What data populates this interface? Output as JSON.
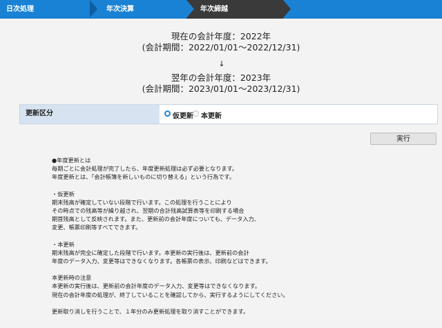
{
  "steps": [
    {
      "label": "日次処理"
    },
    {
      "label": "年次決算"
    },
    {
      "label": "年次締越"
    }
  ],
  "current_year": {
    "line1": "現在の会計年度：2022年",
    "line2": "(会計期間：2022/01/01〜2022/12/31)"
  },
  "arrow": "↓",
  "next_year": {
    "line1": "翌年の会計年度：2023年",
    "line2": "(会計期間：2023/01/01〜2023/12/31)"
  },
  "update_type": {
    "label": "更新区分",
    "options": [
      "仮更新",
      "本更新"
    ],
    "selected": "仮更新"
  },
  "execute_button": "実行",
  "notes": {
    "sec1_title": "●年度更新とは",
    "sec1_l1": "毎期ごとに会計処理が完了したら、年度更新処理は必ず必要となります。",
    "sec1_l2": "年度更新とは、「会計帳簿を新しいものに切り替える」という行為です。",
    "sec2_title": "・仮更新",
    "sec2_l1": "期末残高が確定していない段階で行います。この処理を行うことにより",
    "sec2_l2": "その時点での残高等が繰り越され、翌期の合計残高試算表等を印刷する場合",
    "sec2_l3": "期首残高として反映されます。また、更新前の会計年度についても、データ入力、",
    "sec2_l4": "変更、帳票印刷等すべてできます。",
    "sec3_title": "・本更新",
    "sec3_l1": "期末残高が完全に確定した段階で行います。本更新の実行後は、更新前の会計",
    "sec3_l2": "年度のデータ入力、変更等はできなくなります。各帳票の表示、印刷などはできます。",
    "sec4_title": "本更新時の注意",
    "sec4_l1": "本更新の実行後は、更新前の会計年度のデータ入力、変更等はできなくなります。",
    "sec4_l2": "現在の会計年度の処理が、終了していることを確認してから、実行するようにしてください。",
    "sec5_l1": "更新取り消しを行うことで、１年分のみ更新処理を取り消すことができます。"
  },
  "colors": {
    "step_bar": "#1a82d4",
    "step_active": "#3a3a3a",
    "label_bg": "#d7e3f1",
    "page_bg": "#f3f3f3"
  }
}
